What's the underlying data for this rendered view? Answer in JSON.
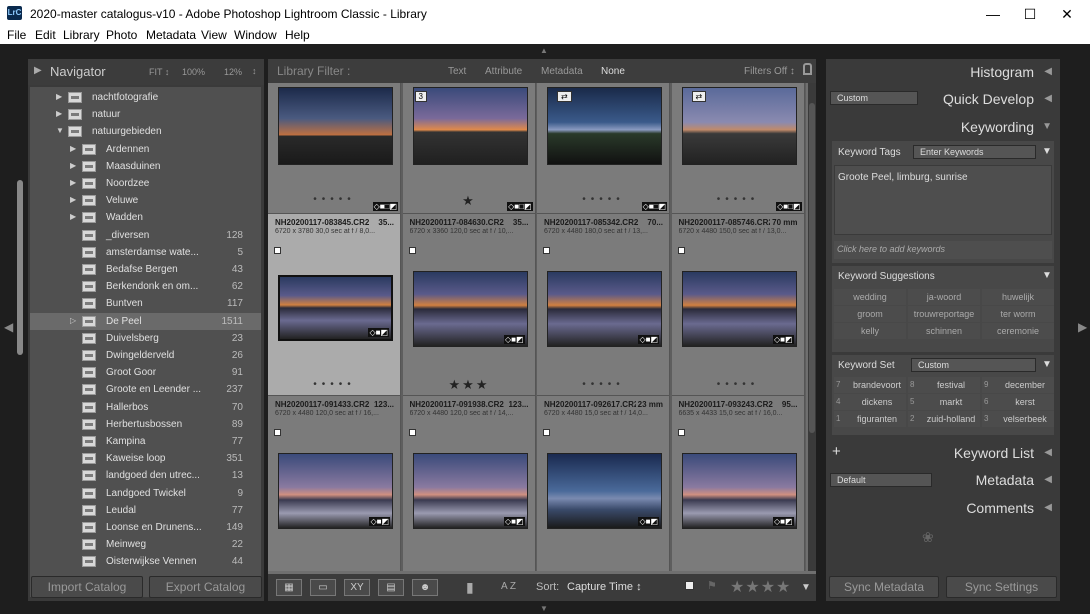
{
  "window": {
    "title": "2020-master catalogus-v10 - Adobe Photoshop Lightroom Classic - Library",
    "app_icon": "LrC"
  },
  "menu": [
    "File",
    "Edit",
    "Library",
    "Photo",
    "Metadata",
    "View",
    "Window",
    "Help"
  ],
  "navigator": {
    "title": "Navigator",
    "fit": "FIT ↕",
    "zoom1": "100%",
    "zoom2": "12%"
  },
  "folders": [
    {
      "name": "nachtfotografie",
      "count": "",
      "level": 1,
      "arrow": "▶"
    },
    {
      "name": "natuur",
      "count": "",
      "level": 1,
      "arrow": "▶"
    },
    {
      "name": "natuurgebieden",
      "count": "",
      "level": 1,
      "arrow": "▼"
    },
    {
      "name": "Ardennen",
      "count": "",
      "level": 2,
      "arrow": "▶"
    },
    {
      "name": "Maasduinen",
      "count": "",
      "level": 2,
      "arrow": "▶"
    },
    {
      "name": "Noordzee",
      "count": "",
      "level": 2,
      "arrow": "▶"
    },
    {
      "name": "Veluwe",
      "count": "",
      "level": 2,
      "arrow": "▶"
    },
    {
      "name": "Wadden",
      "count": "",
      "level": 2,
      "arrow": "▶"
    },
    {
      "name": "_diversen",
      "count": "128",
      "level": 2,
      "arrow": ""
    },
    {
      "name": "amsterdamse wate...",
      "count": "5",
      "level": 2,
      "arrow": ""
    },
    {
      "name": "Bedafse Bergen",
      "count": "43",
      "level": 2,
      "arrow": ""
    },
    {
      "name": "Berkendonk en om...",
      "count": "62",
      "level": 2,
      "arrow": ""
    },
    {
      "name": "Buntven",
      "count": "117",
      "level": 2,
      "arrow": ""
    },
    {
      "name": "De Peel",
      "count": "1511",
      "level": 2,
      "arrow": "▷",
      "selected": true
    },
    {
      "name": "Duivelsberg",
      "count": "23",
      "level": 2,
      "arrow": ""
    },
    {
      "name": "Dwingelderveld",
      "count": "26",
      "level": 2,
      "arrow": ""
    },
    {
      "name": "Groot Goor",
      "count": "91",
      "level": 2,
      "arrow": ""
    },
    {
      "name": "Groote en Leender ...",
      "count": "237",
      "level": 2,
      "arrow": ""
    },
    {
      "name": "Hallerbos",
      "count": "70",
      "level": 2,
      "arrow": ""
    },
    {
      "name": "Herbertusbossen",
      "count": "89",
      "level": 2,
      "arrow": ""
    },
    {
      "name": "Kampina",
      "count": "77",
      "level": 2,
      "arrow": ""
    },
    {
      "name": "Kaweise loop",
      "count": "351",
      "level": 2,
      "arrow": ""
    },
    {
      "name": "landgoed den utrec...",
      "count": "13",
      "level": 2,
      "arrow": ""
    },
    {
      "name": "Landgoed Twickel",
      "count": "9",
      "level": 2,
      "arrow": ""
    },
    {
      "name": "Leudal",
      "count": "77",
      "level": 2,
      "arrow": ""
    },
    {
      "name": "Loonse en Drunens...",
      "count": "149",
      "level": 2,
      "arrow": ""
    },
    {
      "name": "Meinweg",
      "count": "22",
      "level": 2,
      "arrow": ""
    },
    {
      "name": "Oisterwijkse Vennen",
      "count": "44",
      "level": 2,
      "arrow": ""
    }
  ],
  "buttons": {
    "import": "Import Catalog",
    "export": "Export Catalog",
    "sync_meta": "Sync Metadata",
    "sync_settings": "Sync Settings"
  },
  "filter": {
    "label": "Library Filter :",
    "text": "Text",
    "attribute": "Attribute",
    "metadata": "Metadata",
    "none": "None",
    "filters_off": "Filters Off ↕"
  },
  "top_row": [
    {
      "badge": "",
      "style": "dusk1",
      "stars": 0
    },
    {
      "badge": "3",
      "style": "dusk2",
      "stars": 1
    },
    {
      "badge": "⇄",
      "style": "dusk3",
      "stars": 0
    },
    {
      "badge": "⇄",
      "style": "dusk4",
      "stars": 0
    }
  ],
  "row2": [
    {
      "name": "NH20200117-083845.CR2",
      "extra": "35...",
      "dims": "6720 x 3780  30,0 sec at f / 8,0...",
      "style": "lake",
      "stars": 0,
      "selected": true
    },
    {
      "name": "NH20200117-084630.CR2",
      "extra": "35...",
      "dims": "6720 x 3360  120,0 sec at f / 10,...",
      "style": "lake",
      "stars": 3
    },
    {
      "name": "NH20200117-085342.CR2",
      "extra": "70...",
      "dims": "6720 x 4480  180,0 sec at f / 13,...",
      "style": "lake",
      "stars": 0
    },
    {
      "name": "NH20200117-085746.CR2",
      "extra": "70 mm",
      "dims": "6720 x 4480  150,0 sec at f / 13,0...",
      "style": "lake",
      "stars": 0
    }
  ],
  "row3": [
    {
      "name": "NH20200117-091433.CR2",
      "extra": "123...",
      "dims": "6720 x 4480  120,0 sec at f / 16,...",
      "style": "reed"
    },
    {
      "name": "NH20200117-091938.CR2",
      "extra": "123...",
      "dims": "6720 x 4480  120,0 sec at f / 14,...",
      "style": "reed"
    },
    {
      "name": "NH20200117-092617.CR2",
      "extra": "23 mm",
      "dims": "6720 x 4480  15,0 sec at f / 14,0...",
      "style": "blue"
    },
    {
      "name": "NH20200117-093243.CR2",
      "extra": "95...",
      "dims": "6635 x 4433  15,0 sec at f / 16,0...",
      "style": "reed"
    }
  ],
  "toolbar": {
    "sort_label": "Sort:",
    "sort_value": "Capture Time ↕",
    "az": "A Z"
  },
  "right": {
    "histogram": "Histogram",
    "quick_develop": "Quick Develop",
    "qd_preset": "Custom",
    "keywording": "Keywording",
    "kw_tags": "Keyword Tags",
    "kw_mode": "Enter Keywords",
    "kw_value": "Groote Peel, limburg, sunrise",
    "kw_add": "Click here to add keywords",
    "kw_suggestions": "Keyword Suggestions",
    "suggestions": [
      "wedding",
      "ja-woord",
      "huwelijk",
      "groom",
      "trouwreportage",
      "ter worm",
      "kelly",
      "schinnen",
      "ceremonie"
    ],
    "kw_set": "Keyword Set",
    "kw_set_value": "Custom",
    "set_items": [
      [
        "7",
        "brandevoort"
      ],
      [
        "8",
        "festival"
      ],
      [
        "9",
        "december"
      ],
      [
        "4",
        "dickens"
      ],
      [
        "5",
        "markt"
      ],
      [
        "6",
        "kerst"
      ],
      [
        "1",
        "figuranten"
      ],
      [
        "2",
        "zuid-holland"
      ],
      [
        "3",
        "velserbeek"
      ]
    ],
    "keyword_list": "Keyword List",
    "metadata": "Metadata",
    "meta_preset": "Default",
    "comments": "Comments"
  }
}
